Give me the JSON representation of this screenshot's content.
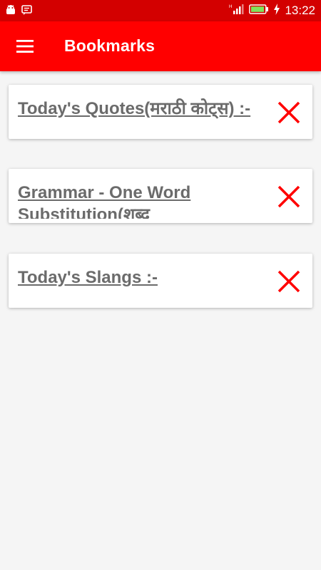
{
  "status_bar": {
    "time": "13:22",
    "left_icons": [
      "android-icon",
      "message-icon"
    ],
    "right_icons": [
      "signal-icon",
      "battery-icon",
      "charging-icon"
    ]
  },
  "app_bar": {
    "title": "Bookmarks",
    "menu_icon": "hamburger-menu-icon"
  },
  "bookmarks": [
    {
      "title": "Today's Quotes(मराठी कोट्स) :-",
      "remove_icon": "close-icon"
    },
    {
      "title": "Grammar - One Word Substitution(शब्द",
      "remove_icon": "close-icon"
    },
    {
      "title": "Today's Slangs :-",
      "remove_icon": "close-icon"
    }
  ],
  "colors": {
    "status_bar": "#d30000",
    "app_bar": "#ff0000",
    "remove_icon": "#ff0000",
    "card_text": "#6b6b6b",
    "background": "#f5f5f5"
  }
}
